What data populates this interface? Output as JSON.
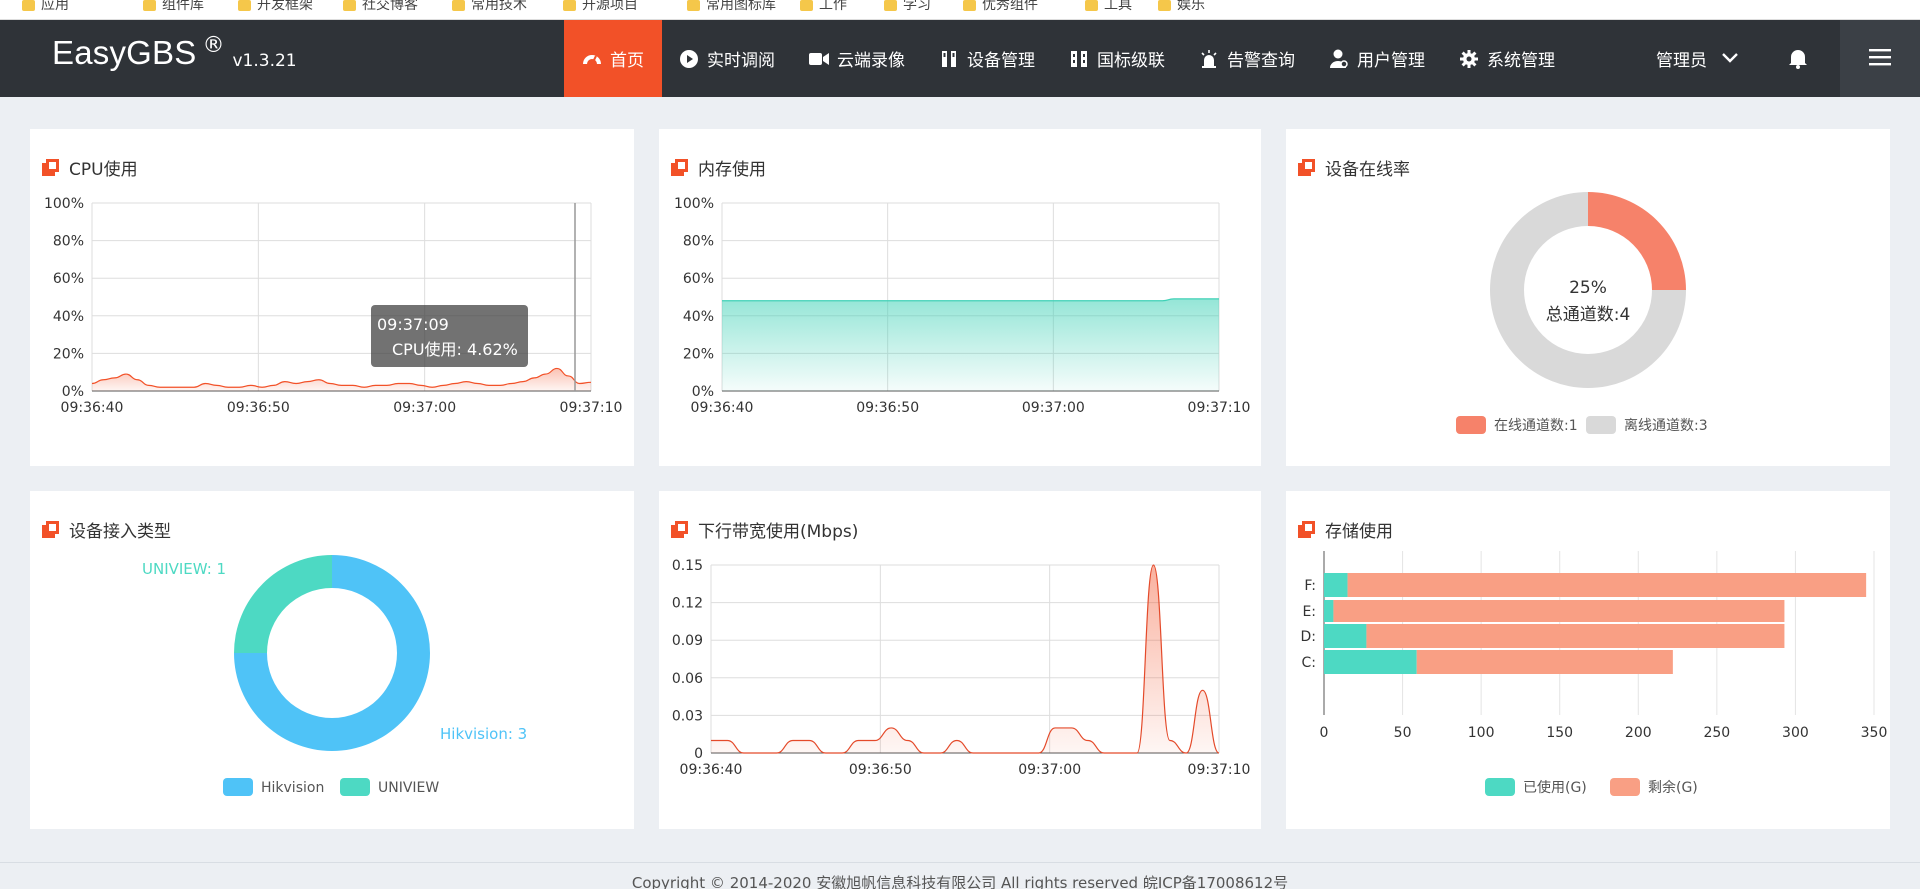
{
  "bookmarks": [
    "应用",
    "组件库",
    "开发框架",
    "社交博客",
    "常用技术",
    "开源项目",
    "常用图标库",
    "工作",
    "学习",
    "优秀组件",
    "工具",
    "娱乐"
  ],
  "brand": {
    "name": "EasyGBS",
    "reg": "®",
    "version": "v1.3.21"
  },
  "nav": [
    {
      "label": "首页",
      "icon": "dashboard-icon",
      "active": true
    },
    {
      "label": "实时调阅",
      "icon": "play-icon"
    },
    {
      "label": "云端录像",
      "icon": "video-camera-icon"
    },
    {
      "label": "设备管理",
      "icon": "device-icon"
    },
    {
      "label": "国标级联",
      "icon": "cascade-icon"
    },
    {
      "label": "告警查询",
      "icon": "alarm-icon"
    },
    {
      "label": "用户管理",
      "icon": "user-icon"
    },
    {
      "label": "系统管理",
      "icon": "gear-icon"
    }
  ],
  "user": {
    "label": "管理员"
  },
  "colors": {
    "accent": "#f25128",
    "topbar": "#2f3338",
    "teal": "#4dd9c3",
    "orange_soft": "#f99f84",
    "blue": "#4fc3f7",
    "gray": "#dcdcdc"
  },
  "cards": {
    "cpu": {
      "title": "CPU使用",
      "tooltip_time": "09:37:09",
      "tooltip_value": "CPU使用: 4.62%",
      "chart_data": {
        "type": "area",
        "x_ticks": [
          "09:36:40",
          "09:36:50",
          "09:37:00",
          "09:37:10"
        ],
        "y_ticks": [
          "0%",
          "20%",
          "40%",
          "60%",
          "80%",
          "100%"
        ],
        "ylim": [
          0,
          100
        ],
        "values": [
          4,
          6,
          7,
          9,
          6,
          3,
          2,
          2,
          2,
          2,
          4,
          3,
          2,
          2,
          3,
          2,
          3,
          5,
          4,
          5,
          6,
          4,
          3,
          3,
          2,
          3,
          3,
          4,
          4,
          3,
          2,
          3,
          4,
          5,
          4,
          3,
          3,
          4,
          5,
          7,
          9,
          12,
          8,
          4,
          4.62
        ]
      }
    },
    "memory": {
      "title": "内存使用",
      "chart_data": {
        "type": "area",
        "x_ticks": [
          "09:36:40",
          "09:36:50",
          "09:37:00",
          "09:37:10"
        ],
        "y_ticks": [
          "0%",
          "20%",
          "40%",
          "60%",
          "80%",
          "100%"
        ],
        "ylim": [
          0,
          100
        ],
        "values": [
          48,
          48,
          48,
          48,
          48,
          48,
          48,
          48,
          48,
          48,
          48,
          48,
          48,
          48,
          48,
          48,
          48,
          48,
          48,
          48,
          48,
          48,
          48,
          48,
          48,
          48,
          48,
          48,
          48,
          48,
          48,
          48,
          48,
          48,
          48,
          48,
          48,
          48,
          48,
          48,
          49,
          49,
          49,
          49,
          49
        ]
      }
    },
    "online": {
      "title": "设备在线率",
      "center_pct": "25%",
      "center_total": "总通道数:4",
      "chart_data": {
        "type": "pie",
        "series": [
          {
            "name": "在线通道数:1",
            "value": 1,
            "color": "#f6826a"
          },
          {
            "name": "离线通道数:3",
            "value": 3,
            "color": "#d9d9d9"
          }
        ]
      }
    },
    "access": {
      "title": "设备接入类型",
      "label_uniview": "UNIVIEW: 1",
      "label_hik": "Hikvision: 3",
      "chart_data": {
        "type": "pie",
        "series": [
          {
            "name": "Hikvision",
            "value": 3,
            "color": "#4fc3f7"
          },
          {
            "name": "UNIVIEW",
            "value": 1,
            "color": "#4dd9c3"
          }
        ]
      }
    },
    "bandwidth": {
      "title": "下行带宽使用(Mbps)",
      "chart_data": {
        "type": "area",
        "x_ticks": [
          "09:36:40",
          "09:36:50",
          "09:37:00",
          "09:37:10"
        ],
        "y_ticks": [
          "0",
          "0.03",
          "0.06",
          "0.09",
          "0.12",
          "0.15"
        ],
        "ylim": [
          0,
          0.15
        ],
        "values": [
          0.01,
          0.01,
          0,
          0,
          0,
          0.01,
          0.01,
          0,
          0,
          0.01,
          0.01,
          0.02,
          0.01,
          0,
          0,
          0.01,
          0,
          0,
          0,
          0,
          0,
          0.02,
          0.02,
          0.01,
          0,
          0,
          0,
          0.15,
          0.01,
          0,
          0.05,
          0
        ]
      }
    },
    "storage": {
      "title": "存储使用",
      "chart_data": {
        "type": "bar",
        "orientation": "horizontal",
        "stacked": true,
        "categories": [
          "F:",
          "E:",
          "D:",
          "C:"
        ],
        "x_ticks": [
          "0",
          "50",
          "100",
          "150",
          "200",
          "250",
          "300",
          "350"
        ],
        "xlim": [
          0,
          350
        ],
        "series": [
          {
            "name": "已使用(G)",
            "color": "#4dd9c3",
            "values": [
              15,
              6,
              27,
              59
            ]
          },
          {
            "name": "剩余(G)",
            "color": "#f99f84",
            "values": [
              330,
              287,
              266,
              163
            ]
          }
        ]
      }
    }
  },
  "footer": {
    "text": "Copyright © 2014-2020 安徽旭帆信息科技有限公司 All rights reserved 皖ICP备17008612号"
  }
}
